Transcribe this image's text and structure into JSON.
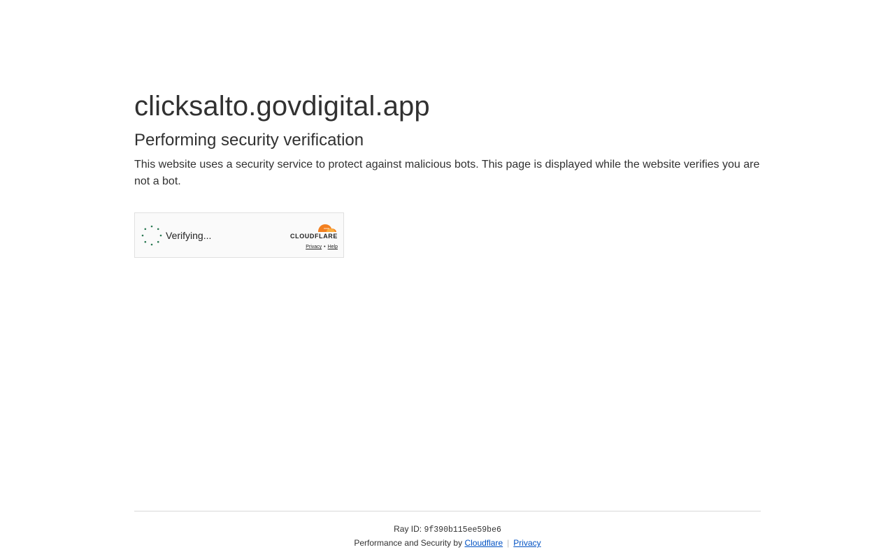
{
  "site": {
    "domain": "clicksalto.govdigital.app"
  },
  "content": {
    "heading": "Performing security verification",
    "description": "This website uses a security service to protect against malicious bots. This page is displayed while the website verifies you are not a bot."
  },
  "widget": {
    "status": "Verifying...",
    "brand": "CLOUDFLARE",
    "privacy_link": "Privacy",
    "separator": "•",
    "help_link": "Help"
  },
  "footer": {
    "ray_label": "Ray ID:",
    "ray_id": "9f390b115ee59be6",
    "performance_prefix": "Performance and Security by",
    "cloudflare_link": "Cloudflare",
    "divider": "|",
    "privacy_link": "Privacy"
  },
  "colors": {
    "spinner": "#2c7a54",
    "cloud_orange": "#f38020",
    "cloud_light": "#faae40",
    "link": "#0051c3"
  }
}
